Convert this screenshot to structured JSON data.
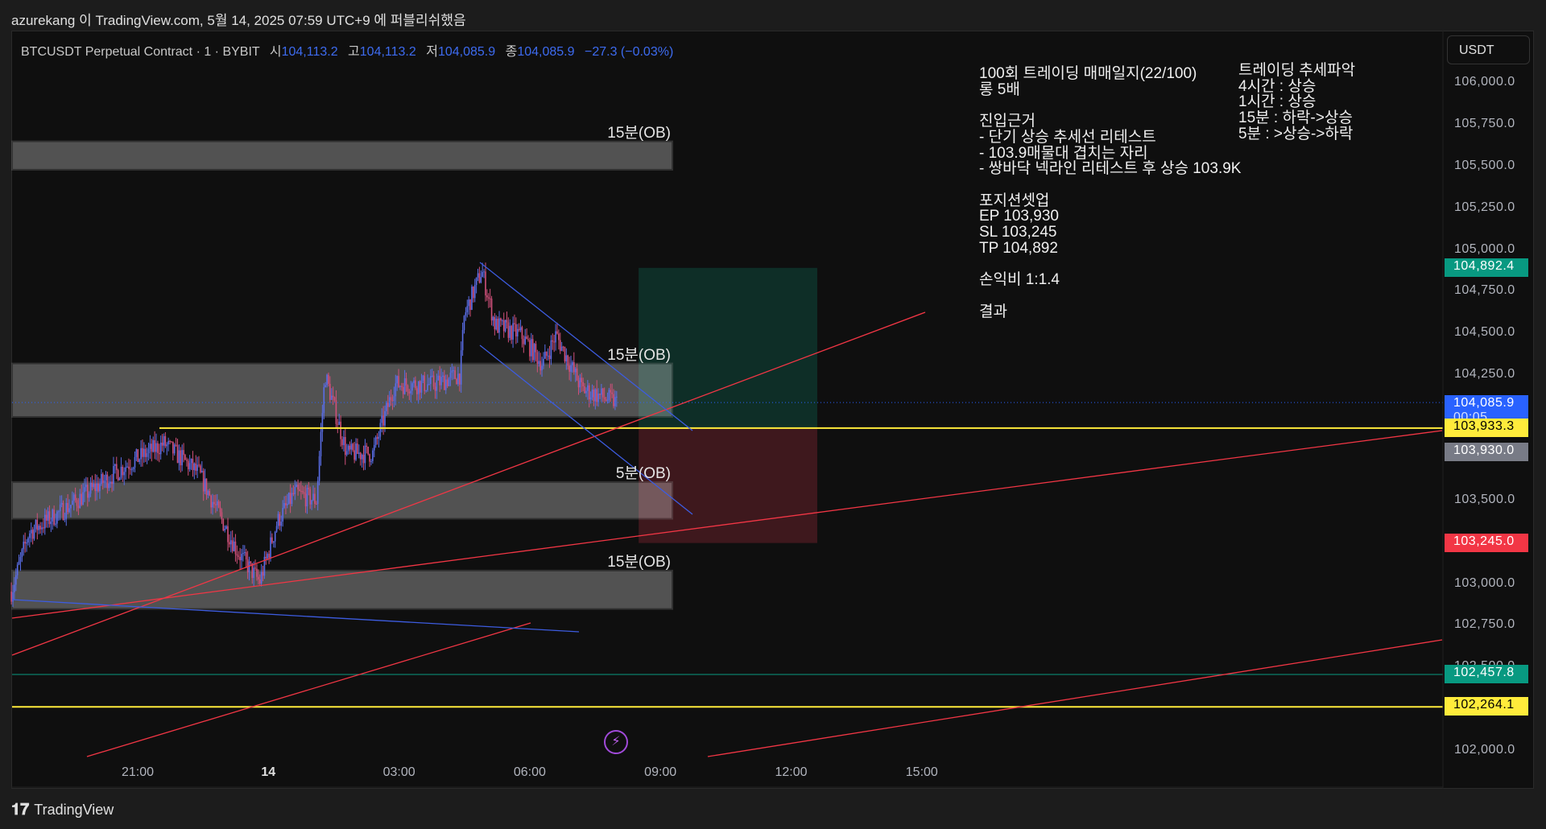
{
  "header": {
    "published": "azurekang 이 TradingView.com, 5월 14, 2025 07:59 UTC+9 에 퍼블리쉬했음"
  },
  "legend": {
    "symbol": "BTCUSDT Perpetual Contract · 1 · BYBIT",
    "o_label": "시",
    "o": "104,113.2",
    "h_label": "고",
    "h": "104,113.2",
    "l_label": "저",
    "l": "104,085.9",
    "c_label": "종",
    "c": "104,085.9",
    "change": "−27.3 (−0.03%)"
  },
  "currency": "USDT",
  "y_ticks": [
    "106,000.0",
    "105,750.0",
    "105,500.0",
    "105,250.0",
    "105,000.0",
    "104,750.0",
    "104,500.0",
    "104,250.0",
    "103,500.0",
    "103,000.0",
    "102,750.0",
    "102,500.0",
    "102,000.0"
  ],
  "y_tick_values": [
    106000,
    105750,
    105500,
    105250,
    105000,
    104750,
    104500,
    104250,
    103500,
    103000,
    102750,
    102500,
    102000
  ],
  "x_ticks": [
    {
      "label": "21:00",
      "h": 21
    },
    {
      "label": "14",
      "h": 24,
      "bold": true
    },
    {
      "label": "03:00",
      "h": 27
    },
    {
      "label": "06:00",
      "h": 30
    },
    {
      "label": "09:00",
      "h": 33
    },
    {
      "label": "12:00",
      "h": 36
    },
    {
      "label": "15:00",
      "h": 39
    }
  ],
  "badges": [
    {
      "text": "104,892.4",
      "price": 104892.4,
      "bg": "#089981",
      "fg": "#ffffff"
    },
    {
      "text": "104,085.9",
      "sub": "00:05",
      "price": 104085.9,
      "bg": "#2962ff",
      "fg": "#ffffff"
    },
    {
      "text": "103,933.3",
      "price": 103933.3,
      "bg": "#ffeb3b",
      "fg": "#000000"
    },
    {
      "text": "103,930.0",
      "price": 103790,
      "bg": "#787b86",
      "fg": "#ffffff"
    },
    {
      "text": "103,245.0",
      "price": 103245,
      "bg": "#f23645",
      "fg": "#ffffff"
    },
    {
      "text": "102,457.8",
      "price": 102457.8,
      "bg": "#089981",
      "fg": "#ffffff"
    },
    {
      "text": "102,264.1",
      "price": 102264.1,
      "bg": "#ffeb3b",
      "fg": "#000000"
    }
  ],
  "ob_zones": [
    {
      "label": "15분(OB)",
      "top": 105650,
      "bottom": 105480
    },
    {
      "label": "15분(OB)",
      "top": 104320,
      "bottom": 104000
    },
    {
      "label": "5분(OB)",
      "top": 103610,
      "bottom": 103390
    },
    {
      "label": "15분(OB)",
      "top": 103080,
      "bottom": 102850
    }
  ],
  "position": {
    "entry": 103933.3,
    "tp": 104892.4,
    "sl": 103245,
    "start_h": 32.5,
    "end_h": 36.6
  },
  "notes": {
    "main": "100회 트레이딩 매매일지(22/100)\n롱 5배\n\n진입근거\n- 단기 상승 추세선 리테스트\n- 103.9매물대 겹치는 자리\n- 쌍바닥 넥라인 리테스트 후 상승 103.9K\n\n포지션셋업\nEP 103,930\nSL 103,245\nTP 104,892\n\n손익비 1:1.4\n\n결과",
    "trend": "트레이딩 추세파악\n4시간 : 상승\n1시간 : 상승\n15분 : 하락->상승\n5분 : >상승->하락"
  },
  "price_path": [
    [
      18.1,
      102954
    ],
    [
      18.5,
      103308
    ],
    [
      19.2,
      103426
    ],
    [
      20.8,
      103722
    ],
    [
      21.6,
      103840
    ],
    [
      22.4,
      103663
    ],
    [
      23.3,
      103189
    ],
    [
      23.8,
      103012
    ],
    [
      24.2,
      103367
    ],
    [
      24.6,
      103544
    ],
    [
      25.1,
      103500
    ],
    [
      25.3,
      104254
    ],
    [
      25.8,
      103781
    ],
    [
      26.4,
      103781
    ],
    [
      26.9,
      104195
    ],
    [
      27.8,
      104195
    ],
    [
      28.4,
      104254
    ],
    [
      28.5,
      104609
    ],
    [
      28.9,
      104876
    ],
    [
      29.2,
      104550
    ],
    [
      29.8,
      104491
    ],
    [
      30.3,
      104314
    ],
    [
      30.6,
      104491
    ],
    [
      31.2,
      104166
    ],
    [
      32.0,
      104086
    ]
  ],
  "logo": "TradingView",
  "icons": {
    "bolt": "⚡"
  }
}
